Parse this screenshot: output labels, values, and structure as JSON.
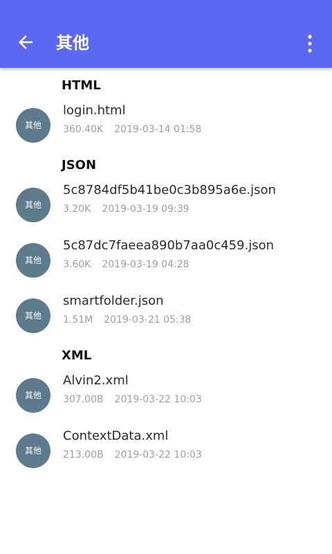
{
  "appbar": {
    "title": "其他",
    "back_icon": "arrow-left-icon",
    "more_icon": "more-vertical-icon",
    "background": "#5b69f2"
  },
  "avatar_label": "其他",
  "avatar_color": "#5e7a8d",
  "sections": [
    {
      "header": "HTML",
      "files": [
        {
          "name": "login.html",
          "size": "360.40K",
          "date": "2019-03-14 01:58"
        }
      ]
    },
    {
      "header": "JSON",
      "files": [
        {
          "name": "5c8784df5b41be0c3b895a6e.json",
          "size": "3.20K",
          "date": "2019-03-19 09:39"
        },
        {
          "name": "5c87dc7faeea890b7aa0c459.json",
          "size": "3.60K",
          "date": "2019-03-19 04:28"
        },
        {
          "name": "smartfolder.json",
          "size": "1.51M",
          "date": "2019-03-21 05:38"
        }
      ]
    },
    {
      "header": "XML",
      "files": [
        {
          "name": "Alvin2.xml",
          "size": "307.00B",
          "date": "2019-03-22 10:03"
        },
        {
          "name": "ContextData.xml",
          "size": "213.00B",
          "date": "2019-03-22 10:03"
        }
      ]
    }
  ]
}
